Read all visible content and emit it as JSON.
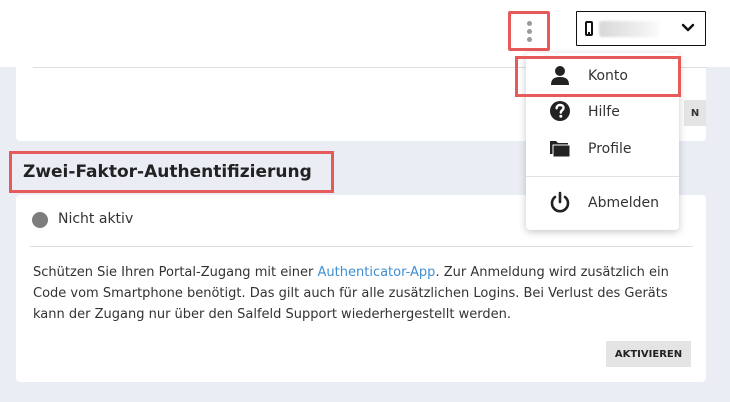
{
  "header": {
    "device_select": {
      "value": "",
      "chevron_icon": "chevron-down-icon",
      "device_icon": "smartphone-icon"
    },
    "more_icon": "vertical-dots-icon"
  },
  "card1": {
    "partial_button_label": "N"
  },
  "two_factor": {
    "heading": "Zwei-Faktor-Authentifizierung",
    "status": "Nicht aktiv",
    "description_before": "Schützen Sie Ihren Portal-Zugang mit einer ",
    "description_link": "Authenticator-App",
    "description_after": ". Zur Anmeldung wird zusätzlich ein Code vom Smartphone benötigt. Das gilt auch für alle zusätzlichen Logins. Bei Verlust des Geräts kann der Zugang nur über den Salfeld Support wiederhergestellt werden.",
    "activate_label": "AKTIVIEREN"
  },
  "menu": {
    "items": [
      {
        "label": "Konto",
        "icon": "user-icon"
      },
      {
        "label": "Hilfe",
        "icon": "help-icon"
      },
      {
        "label": "Profile",
        "icon": "folder-icon"
      },
      {
        "label": "Abmelden",
        "icon": "power-icon"
      }
    ]
  },
  "colors": {
    "highlight": "#e65a5a",
    "link": "#3f8fd2",
    "background": "#ebedf5"
  }
}
